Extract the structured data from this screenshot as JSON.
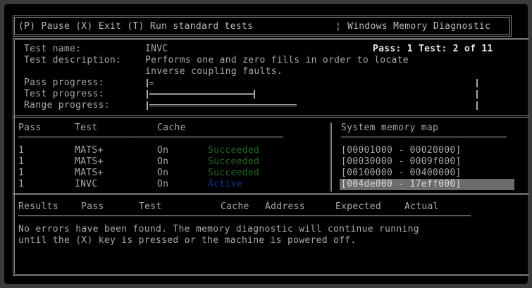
{
  "topbar": {
    "keys": "(P) Pause (X) Exit (T) Run standard tests",
    "title": "Windows Memory Diagnostic",
    "separator": "¦"
  },
  "info": {
    "test_name_label": "Test name:",
    "test_name_value": "INVC",
    "test_desc_label": "Test description:",
    "test_desc_line1": "Performs one and zero fills in order to locate",
    "test_desc_line2": "inverse coupling faults.",
    "pass_test_status": "Pass: 1 Test: 2 of 11",
    "pass_progress_label": "Pass progress:",
    "test_progress_label": "Test progress:",
    "range_progress_label": "Range progress:",
    "pass_progress": 0.01,
    "test_progress": 0.32,
    "range_progress": 0.45
  },
  "tests_table": {
    "headers": {
      "pass": "Pass",
      "test": "Test",
      "cache": "Cache"
    },
    "rows": [
      {
        "pass": "1",
        "test": "MATS+",
        "cache": "On",
        "status": "Succeeded",
        "status_color": "#1c6a1c"
      },
      {
        "pass": "1",
        "test": "MATS+",
        "cache": "On",
        "status": "Succeeded",
        "status_color": "#1c6a1c"
      },
      {
        "pass": "1",
        "test": "MATS+",
        "cache": "On",
        "status": "Succeeded",
        "status_color": "#1c6a1c"
      },
      {
        "pass": "1",
        "test": "INVC",
        "cache": "On",
        "status": "Active",
        "status_color": "#1c2c8c"
      }
    ]
  },
  "memory_map": {
    "header": "System memory map",
    "ranges": [
      "[00001000 - 00020000]",
      "[00030000 - 0009f000]",
      "[00100000 - 00400000]",
      "[004de000 - 17eff000]"
    ],
    "selected_index": 3
  },
  "results": {
    "headers": {
      "results": "Results",
      "pass": "Pass",
      "test": "Test",
      "cache": "Cache",
      "address": "Address",
      "expected": "Expected",
      "actual": "Actual"
    },
    "message_line1": "No errors have been found. The memory diagnostic will continue running",
    "message_line2": "until the (X) key is pressed or the machine is powered off."
  }
}
